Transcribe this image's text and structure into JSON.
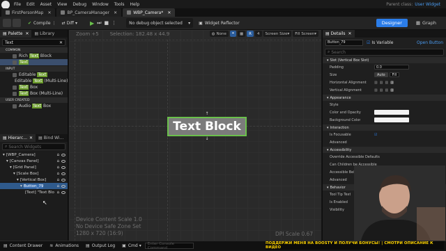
{
  "menu": {
    "items": [
      "File",
      "Edit",
      "Asset",
      "View",
      "Debug",
      "Window",
      "Tools",
      "Help"
    ],
    "parent_class_label": "Parent class:",
    "parent_class_value": "User Widget"
  },
  "tabs": [
    {
      "label": "FirstPersonMap",
      "active": false
    },
    {
      "label": "BP_CameraManager",
      "active": false
    },
    {
      "label": "WBP_Camera*",
      "active": true
    }
  ],
  "toolbar": {
    "compile": "Compile",
    "diff": "Diff",
    "debug_select": "No debug object selected",
    "widget_reflector": "Widget Reflector",
    "designer": "Designer",
    "graph": "Graph"
  },
  "palette": {
    "tabs": [
      "Palette",
      "Library"
    ],
    "search": "Text",
    "categories": [
      {
        "name": "COMMON",
        "items": [
          {
            "pre": "Rich ",
            "hl": "Text",
            "post": " Block",
            "sel": false
          },
          {
            "pre": "",
            "hl": "Text",
            "post": "",
            "sel": true
          }
        ]
      },
      {
        "name": "INPUT",
        "items": [
          {
            "pre": "Editable ",
            "hl": "Text",
            "post": "",
            "sel": false
          },
          {
            "pre": "Editable ",
            "hl": "Text",
            "post": " (Multi-Line)",
            "sel": false
          },
          {
            "pre": "",
            "hl": "Text",
            "post": " Box",
            "sel": false
          },
          {
            "pre": "",
            "hl": "Text",
            "post": " Box (Multi-Line)",
            "sel": false
          }
        ]
      },
      {
        "name": "USER CREATED",
        "items": [
          {
            "pre": "Audio ",
            "hl": "Text",
            "post": " Box",
            "sel": false
          }
        ]
      }
    ]
  },
  "hierarchy": {
    "tabs": [
      "Hierarc...",
      "Bind Wi..."
    ],
    "search_placeholder": "Search Widgets",
    "items": [
      {
        "label": "[WBP_Camera]",
        "indent": 0,
        "sel": false
      },
      {
        "label": "[Canvas Panel]",
        "indent": 1,
        "sel": false
      },
      {
        "label": "[Grid Panel]",
        "indent": 2,
        "sel": false
      },
      {
        "label": "[Scale Box]",
        "indent": 3,
        "sel": false
      },
      {
        "label": "[Vertical Box]",
        "indent": 4,
        "sel": false
      },
      {
        "label": "Button_79",
        "indent": 5,
        "sel": true
      },
      {
        "label": "[Text] \"Text Blo",
        "indent": 6,
        "sel": false
      }
    ]
  },
  "canvas": {
    "zoom": "Zoom +5",
    "selection": "Selection: 182.48 x 44.9",
    "none": "None",
    "r": "R",
    "snap": "4",
    "screen_size": "Screen Size",
    "fill_screen": "Fill Screen",
    "widget_text": "Text Block",
    "foot_1": "Device Content Scale 1.0",
    "foot_2": "No Device Safe Zone Set",
    "foot_3": "1280 x 720 (16:9)",
    "dpi": "DPI Scale 0.67"
  },
  "details": {
    "tab": "Details",
    "name": "Button_79",
    "is_variable": "Is Variable",
    "open_button": "Open Button",
    "search_placeholder": "Search",
    "sections": [
      {
        "title": "Slot (Vertical Box Slot)",
        "props": [
          {
            "label": "Padding",
            "kind": "box",
            "value": "0.0"
          },
          {
            "label": "Size",
            "kind": "size",
            "value": ""
          },
          {
            "label": "Horizontal Alignment",
            "kind": "align",
            "value": ""
          },
          {
            "label": "Vertical Alignment",
            "kind": "align",
            "value": ""
          }
        ]
      },
      {
        "title": "Appearance",
        "props": [
          {
            "label": "Style",
            "kind": "none",
            "value": ""
          },
          {
            "label": "Color and Opacity",
            "kind": "white",
            "value": ""
          },
          {
            "label": "Background Color",
            "kind": "white",
            "value": ""
          }
        ]
      },
      {
        "title": "Interaction",
        "props": [
          {
            "label": "Is Focusable",
            "kind": "check",
            "value": ""
          },
          {
            "label": "Advanced",
            "kind": "none",
            "value": ""
          }
        ]
      },
      {
        "title": "Accessibility",
        "props": [
          {
            "label": "Override Accessible Defaults",
            "kind": "none",
            "value": ""
          },
          {
            "label": "Can Children be Accessible",
            "kind": "none",
            "value": ""
          },
          {
            "label": "Accessible Behavior",
            "kind": "none",
            "value": ""
          },
          {
            "label": "Advanced",
            "kind": "none",
            "value": ""
          }
        ]
      },
      {
        "title": "Behavior",
        "props": [
          {
            "label": "Tool Tip Text",
            "kind": "none",
            "value": ""
          },
          {
            "label": "Is Enabled",
            "kind": "check",
            "value": ""
          },
          {
            "label": "Visibility",
            "kind": "none",
            "value": ""
          }
        ]
      }
    ],
    "size_auto": "Auto",
    "size_fill": "Fill"
  },
  "statusbar": {
    "content_drawer": "Content Drawer",
    "animations": "Animations",
    "output_log": "Output Log",
    "cmd": "Cmd",
    "console_placeholder": "Enter Console Command"
  },
  "banner": "ПОДДЕРЖИ МЕНЯ НА BOOSTY И ПОЛУЧИ БОНУСЫ! | СМОТРИ ОПИСАНИЕ К ВИДЕО",
  "colors": {
    "accent": "#2b7de9",
    "highlight": "#6a9a2a",
    "selection": "#2f5a8c",
    "widget_border": "#6ac04b",
    "banner_text": "#ffd400"
  }
}
